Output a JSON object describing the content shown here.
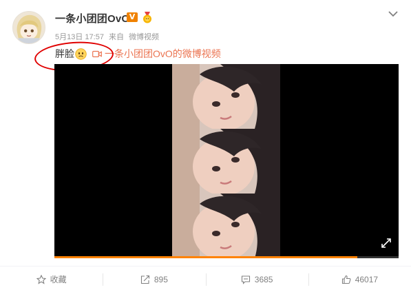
{
  "post": {
    "username": "一条小团团OvO",
    "vip_badge": "V",
    "date": "5月13日 17:57",
    "source_prefix": "来自",
    "source": "微博视频",
    "text": "胖脸",
    "emoji_icon": "sad-face-icon",
    "video_link_text": "一条小团团OvO的微博视频"
  },
  "video": {
    "progress_fraction": 0.88
  },
  "actions": {
    "favorite_label": "收藏",
    "repost_count": "895",
    "comment_count": "3685",
    "like_count": "46017"
  },
  "colors": {
    "link": "#eb7350",
    "badge": "#f08200",
    "progress": "#ff8200",
    "annotation": "#e00000"
  }
}
